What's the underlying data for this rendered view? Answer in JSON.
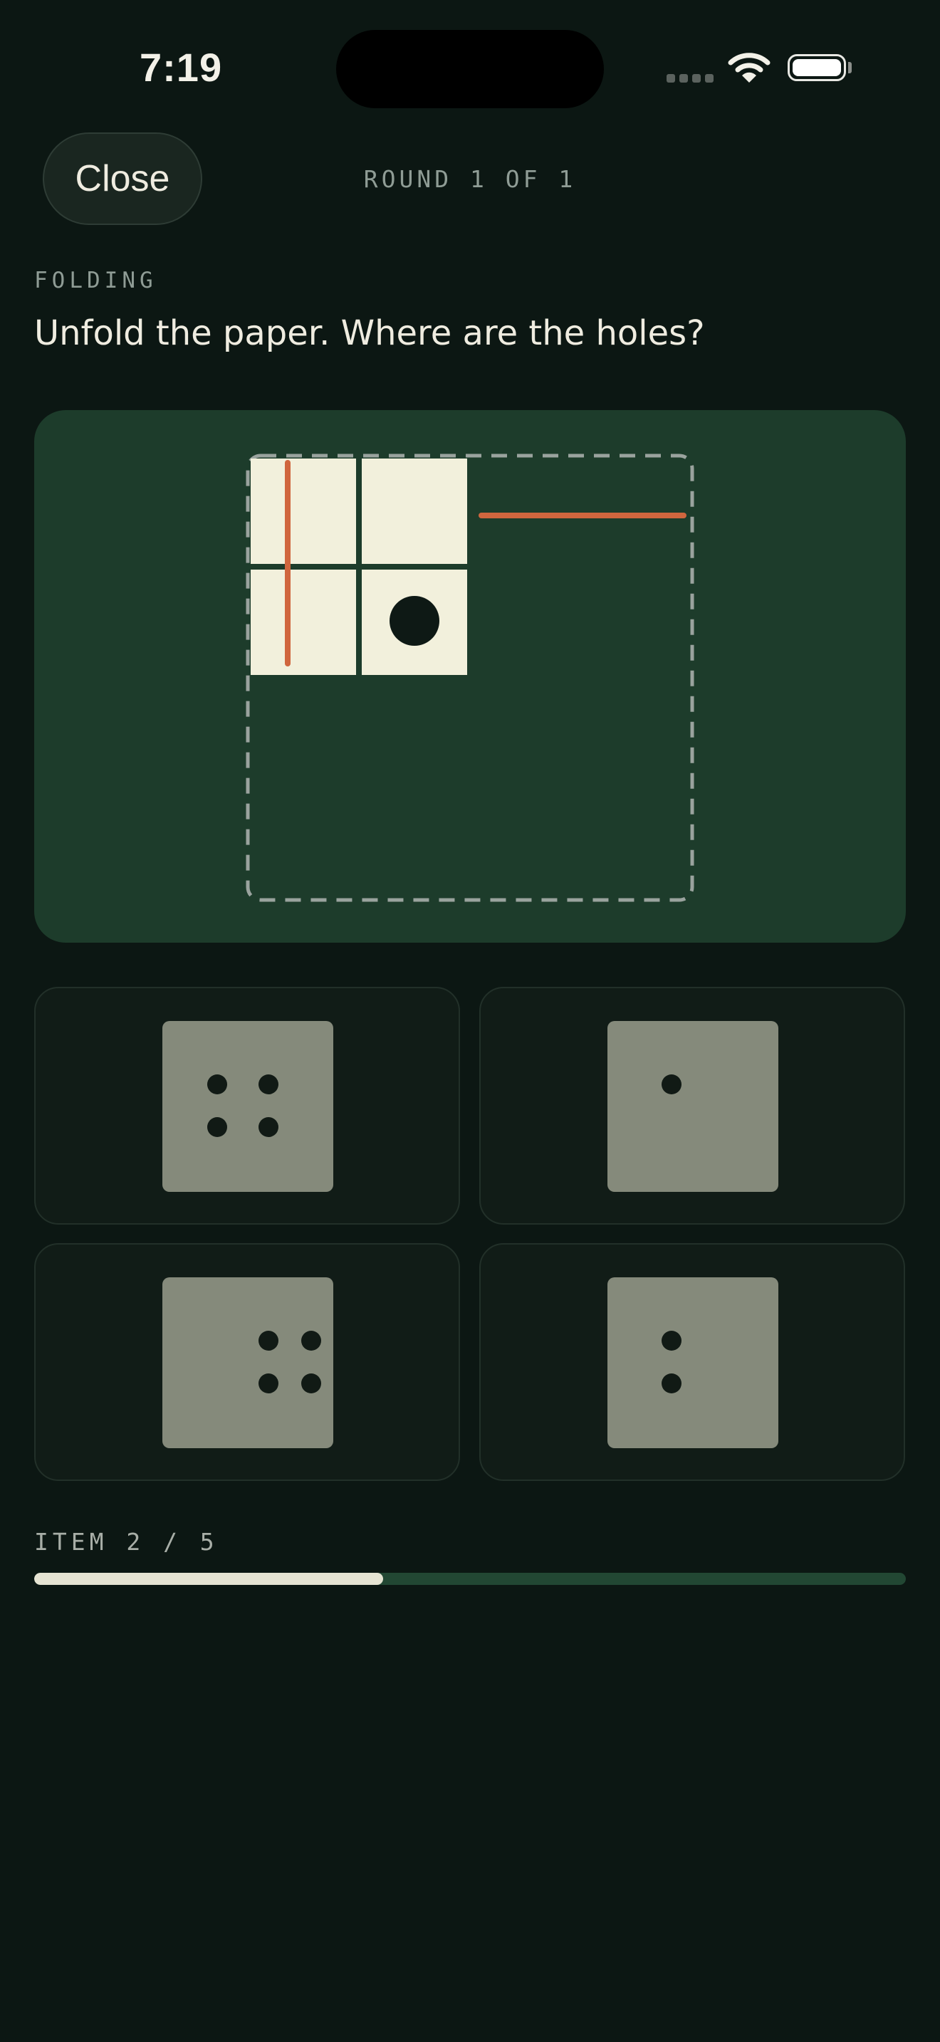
{
  "status_bar": {
    "time": "7:19",
    "icons": [
      "cellular-signal-icon",
      "wifi-icon",
      "battery-icon"
    ]
  },
  "header": {
    "close_label": "Close",
    "round_label": "ROUND 1 OF 1"
  },
  "question": {
    "category": "FOLDING",
    "prompt": "Unfold the paper. Where are the holes?"
  },
  "puzzle": {
    "folded_grid": {
      "rows": 2,
      "cols": 2,
      "hole": {
        "row": 1,
        "col": 1
      }
    },
    "fold_lines": [
      "vertical",
      "horizontal"
    ]
  },
  "options": [
    {
      "id": "a",
      "holes": [
        [
          0.32,
          0.37
        ],
        [
          0.62,
          0.37
        ],
        [
          0.32,
          0.62
        ],
        [
          0.62,
          0.62
        ]
      ]
    },
    {
      "id": "b",
      "holes": [
        [
          0.37,
          0.37
        ]
      ]
    },
    {
      "id": "c",
      "holes": [
        [
          0.62,
          0.37
        ],
        [
          0.87,
          0.37
        ],
        [
          0.62,
          0.62
        ],
        [
          0.87,
          0.62
        ]
      ]
    },
    {
      "id": "d",
      "holes": [
        [
          0.37,
          0.37
        ],
        [
          0.37,
          0.62
        ]
      ]
    }
  ],
  "progress": {
    "label": "ITEM 2 / 5",
    "current": 2,
    "total": 5
  },
  "colors": {
    "background": "#0c1713",
    "card": "#1d3c2b",
    "paper": "#f2f0dc",
    "fold_line": "#d0663e",
    "tile": "#858a7b",
    "progress_fill": "#e6e4d3",
    "progress_track": "#224733"
  }
}
